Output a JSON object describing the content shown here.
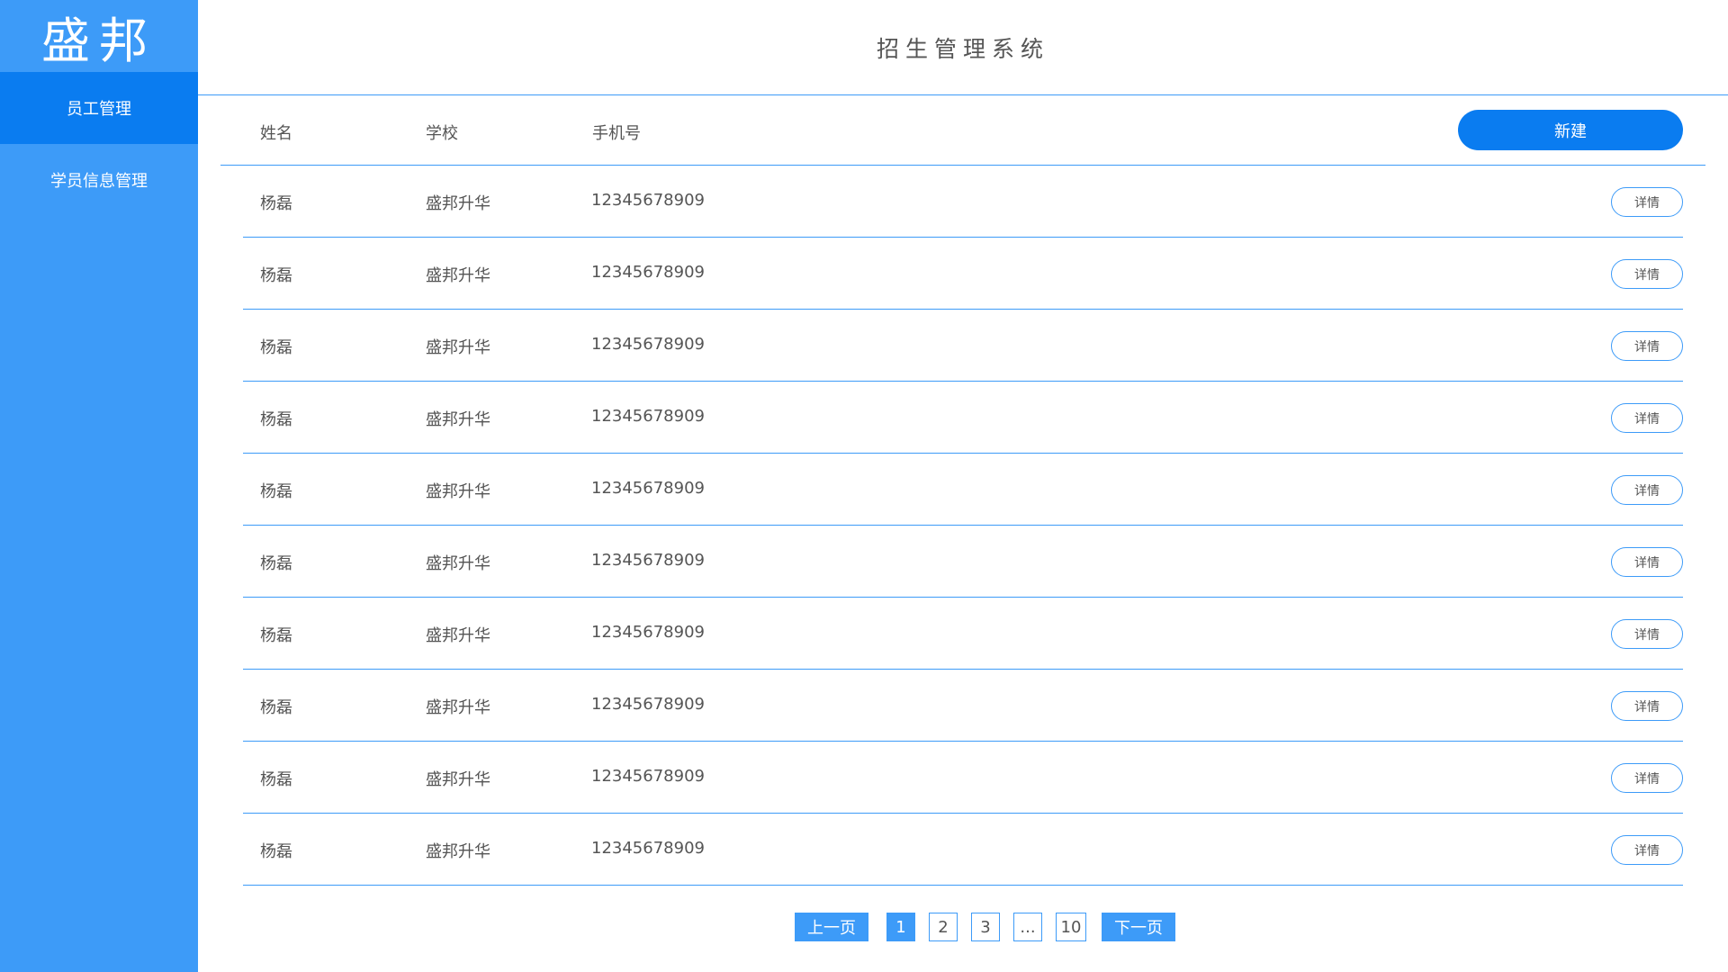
{
  "sidebar": {
    "logo": "盛邦",
    "items": [
      {
        "label": "员工管理",
        "active": true
      },
      {
        "label": "学员信息管理",
        "active": false
      }
    ]
  },
  "header": {
    "title": "招生管理系统"
  },
  "table": {
    "columns": [
      "姓名",
      "学校",
      "手机号"
    ],
    "new_label": "新建",
    "detail_label": "详情",
    "rows": [
      {
        "name": "杨磊",
        "school": "盛邦升华",
        "phone": "12345678909"
      },
      {
        "name": "杨磊",
        "school": "盛邦升华",
        "phone": "12345678909"
      },
      {
        "name": "杨磊",
        "school": "盛邦升华",
        "phone": "12345678909"
      },
      {
        "name": "杨磊",
        "school": "盛邦升华",
        "phone": "12345678909"
      },
      {
        "name": "杨磊",
        "school": "盛邦升华",
        "phone": "12345678909"
      },
      {
        "name": "杨磊",
        "school": "盛邦升华",
        "phone": "12345678909"
      },
      {
        "name": "杨磊",
        "school": "盛邦升华",
        "phone": "12345678909"
      },
      {
        "name": "杨磊",
        "school": "盛邦升华",
        "phone": "12345678909"
      },
      {
        "name": "杨磊",
        "school": "盛邦升华",
        "phone": "12345678909"
      },
      {
        "name": "杨磊",
        "school": "盛邦升华",
        "phone": "12345678909"
      }
    ]
  },
  "pagination": {
    "prev_label": "上一页",
    "next_label": "下一页",
    "pages": [
      "1",
      "2",
      "3",
      "...",
      "10"
    ],
    "current": "1"
  },
  "colors": {
    "accent": "#3d9bf8",
    "accent_dark": "#0a7cf0",
    "text": "#555555"
  }
}
